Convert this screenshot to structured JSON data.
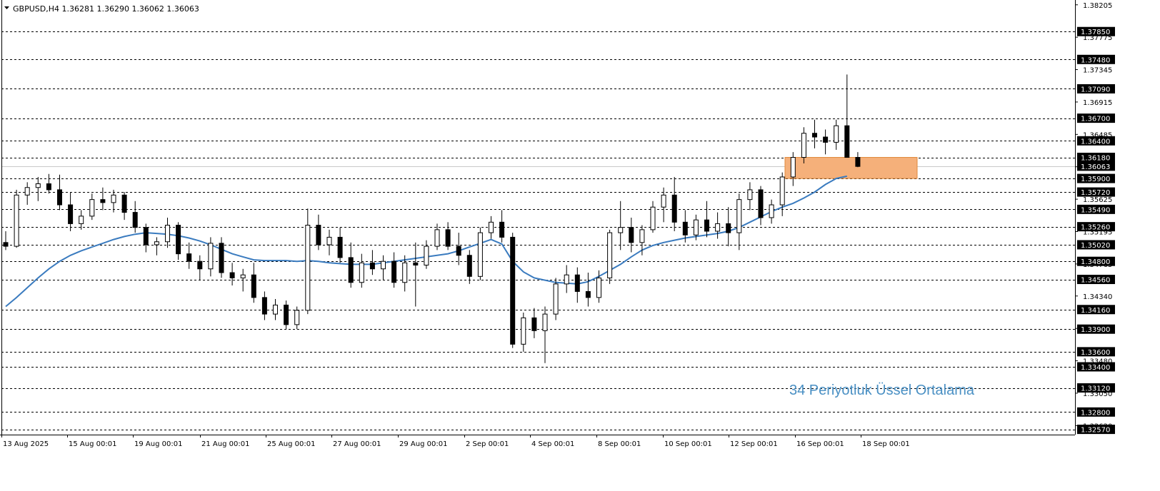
{
  "window": {
    "symbol_title": "GBPUSD,H4  1.36281 1.36290 1.36062 1.36063"
  },
  "annotation": "34 Periyotluk Üssel Ortalama",
  "colors": {
    "ema": "#3a7bbf",
    "zone_fill": "#f5b07a",
    "zone_border": "#e08a3c",
    "label_bg": "#000000",
    "label_text": "#ffffff",
    "grid": "#000000",
    "current_price_line": "#c8c8c8",
    "bear": "#000000",
    "bull": "#ffffff"
  },
  "chart_data": {
    "type": "candlestick",
    "symbol": "GBPUSD",
    "timeframe": "H4",
    "ohlc_header": {
      "open": 1.36281,
      "high": 1.3629,
      "low": 1.36062,
      "close": 1.36063
    },
    "ylim": [
      1.325,
      1.3825
    ],
    "y_tick_labels": [
      "1.38205",
      "1.37775",
      "1.37345",
      "1.36915",
      "1.36485",
      "1.36055",
      "1.35625",
      "1.35195",
      "1.34765",
      "1.34340",
      "1.33910",
      "1.33480",
      "1.33050",
      "1.32620"
    ],
    "horizontal_levels": [
      "1.37850",
      "1.37480",
      "1.37090",
      "1.36700",
      "1.36400",
      "1.36180",
      "1.35900",
      "1.35720",
      "1.35490",
      "1.35260",
      "1.35020",
      "1.34800",
      "1.34560",
      "1.34160",
      "1.33900",
      "1.33600",
      "1.33400",
      "1.33120",
      "1.32800",
      "1.32570"
    ],
    "current_price": "1.36063",
    "x_tick_labels": [
      "13 Aug 2025",
      "15 Aug 00:01",
      "19 Aug 00:01",
      "21 Aug 00:01",
      "25 Aug 00:01",
      "27 Aug 00:01",
      "29 Aug 00:01",
      "2 Sep 00:01",
      "4 Sep 00:01",
      "8 Sep 00:01",
      "10 Sep 00:01",
      "12 Sep 00:01",
      "16 Sep 00:01",
      "18 Sep 00:01"
    ],
    "zone": {
      "top": 1.3618,
      "bottom": 1.359
    },
    "ema_period": 34,
    "ema": [
      1.342,
      1.3432,
      1.3445,
      1.3458,
      1.347,
      1.348,
      1.3488,
      1.3494,
      1.3499,
      1.3504,
      1.3509,
      1.3513,
      1.3516,
      1.3518,
      1.3517,
      1.3516,
      1.3514,
      1.3511,
      1.3507,
      1.3502,
      1.3496,
      1.349,
      1.3486,
      1.3482,
      1.3481,
      1.3481,
      1.3481,
      1.348,
      1.3481,
      1.348,
      1.3478,
      1.3477,
      1.3476,
      1.3476,
      1.3476,
      1.3478,
      1.348,
      1.3482,
      1.3484,
      1.3486,
      1.3488,
      1.349,
      1.3494,
      1.3499,
      1.3504,
      1.3509,
      1.3503,
      1.348,
      1.3466,
      1.3458,
      1.3455,
      1.3452,
      1.3451,
      1.345,
      1.3453,
      1.346,
      1.3468,
      1.3476,
      1.3486,
      1.3495,
      1.3501,
      1.3505,
      1.3508,
      1.3511,
      1.3513,
      1.3515,
      1.3517,
      1.352,
      1.3525,
      1.3532,
      1.3539,
      1.3546,
      1.3552,
      1.3557,
      1.3564,
      1.3572,
      1.3582,
      1.359,
      1.3593
    ],
    "candles": [
      [
        1.3505,
        1.352,
        1.3495,
        1.35
      ],
      [
        1.35,
        1.3575,
        1.3498,
        1.3568
      ],
      [
        1.3568,
        1.3585,
        1.3555,
        1.3578
      ],
      [
        1.3578,
        1.3592,
        1.356,
        1.3583
      ],
      [
        1.3583,
        1.3596,
        1.357,
        1.3575
      ],
      [
        1.3575,
        1.3595,
        1.3548,
        1.3555
      ],
      [
        1.3555,
        1.3572,
        1.352,
        1.353
      ],
      [
        1.353,
        1.3548,
        1.3522,
        1.354
      ],
      [
        1.354,
        1.357,
        1.3535,
        1.3562
      ],
      [
        1.3562,
        1.3578,
        1.3548,
        1.3558
      ],
      [
        1.3558,
        1.3575,
        1.3545,
        1.3568
      ],
      [
        1.3568,
        1.3572,
        1.3535,
        1.3545
      ],
      [
        1.3545,
        1.356,
        1.3518,
        1.3525
      ],
      [
        1.3525,
        1.353,
        1.3492,
        1.3502
      ],
      [
        1.3502,
        1.3512,
        1.3488,
        1.3506
      ],
      [
        1.3506,
        1.3538,
        1.3498,
        1.3528
      ],
      [
        1.3528,
        1.3532,
        1.3482,
        1.349
      ],
      [
        1.349,
        1.3505,
        1.347,
        1.348
      ],
      [
        1.348,
        1.3488,
        1.3455,
        1.347
      ],
      [
        1.347,
        1.3512,
        1.346,
        1.3504
      ],
      [
        1.3504,
        1.3512,
        1.3458,
        1.3465
      ],
      [
        1.3465,
        1.3478,
        1.3448,
        1.3458
      ],
      [
        1.3458,
        1.347,
        1.344,
        1.3462
      ],
      [
        1.3462,
        1.3478,
        1.3425,
        1.3432
      ],
      [
        1.3432,
        1.344,
        1.3402,
        1.341
      ],
      [
        1.341,
        1.343,
        1.3402,
        1.3422
      ],
      [
        1.3422,
        1.3428,
        1.339,
        1.3396
      ],
      [
        1.3396,
        1.342,
        1.339,
        1.3415
      ],
      [
        1.3415,
        1.355,
        1.341,
        1.3528
      ],
      [
        1.3528,
        1.3542,
        1.3495,
        1.3502
      ],
      [
        1.3502,
        1.3522,
        1.3488,
        1.3512
      ],
      [
        1.3512,
        1.3525,
        1.3478,
        1.3485
      ],
      [
        1.3485,
        1.3505,
        1.3445,
        1.3452
      ],
      [
        1.3452,
        1.349,
        1.3445,
        1.3478
      ],
      [
        1.3478,
        1.3495,
        1.3462,
        1.347
      ],
      [
        1.347,
        1.3488,
        1.3455,
        1.348
      ],
      [
        1.348,
        1.3492,
        1.3445,
        1.3452
      ],
      [
        1.3452,
        1.3488,
        1.344,
        1.3478
      ],
      [
        1.3478,
        1.3505,
        1.342,
        1.3475
      ],
      [
        1.3475,
        1.3508,
        1.347,
        1.35
      ],
      [
        1.35,
        1.353,
        1.3495,
        1.3522
      ],
      [
        1.3522,
        1.3532,
        1.3495,
        1.35
      ],
      [
        1.35,
        1.3518,
        1.3475,
        1.3488
      ],
      [
        1.3488,
        1.3495,
        1.345,
        1.346
      ],
      [
        1.346,
        1.3525,
        1.3455,
        1.3518
      ],
      [
        1.3518,
        1.354,
        1.351,
        1.3532
      ],
      [
        1.3532,
        1.3548,
        1.3505,
        1.3512
      ],
      [
        1.3512,
        1.3518,
        1.3365,
        1.337
      ],
      [
        1.337,
        1.3412,
        1.336,
        1.3405
      ],
      [
        1.3405,
        1.3418,
        1.3378,
        1.3388
      ],
      [
        1.3388,
        1.342,
        1.3345,
        1.341
      ],
      [
        1.341,
        1.3458,
        1.3402,
        1.345
      ],
      [
        1.345,
        1.3475,
        1.3438,
        1.3462
      ],
      [
        1.3462,
        1.3472,
        1.3425,
        1.344
      ],
      [
        1.344,
        1.3465,
        1.342,
        1.3432
      ],
      [
        1.3432,
        1.3468,
        1.3425,
        1.3458
      ],
      [
        1.3458,
        1.3522,
        1.345,
        1.3518
      ],
      [
        1.3518,
        1.356,
        1.3495,
        1.3525
      ],
      [
        1.3525,
        1.3538,
        1.3492,
        1.3505
      ],
      [
        1.3505,
        1.3528,
        1.3488,
        1.3522
      ],
      [
        1.3522,
        1.356,
        1.3518,
        1.3552
      ],
      [
        1.3552,
        1.3578,
        1.3532,
        1.3568
      ],
      [
        1.3568,
        1.3592,
        1.352,
        1.3532
      ],
      [
        1.3532,
        1.3548,
        1.3505,
        1.3515
      ],
      [
        1.3515,
        1.3542,
        1.3508,
        1.3535
      ],
      [
        1.3535,
        1.356,
        1.3512,
        1.352
      ],
      [
        1.352,
        1.3545,
        1.351,
        1.353
      ],
      [
        1.353,
        1.3552,
        1.35,
        1.3518
      ],
      [
        1.3518,
        1.357,
        1.3495,
        1.3562
      ],
      [
        1.3562,
        1.3585,
        1.3548,
        1.3575
      ],
      [
        1.3575,
        1.358,
        1.3528,
        1.3538
      ],
      [
        1.3538,
        1.3562,
        1.353,
        1.3555
      ],
      [
        1.3555,
        1.3598,
        1.354,
        1.3592
      ],
      [
        1.3592,
        1.3625,
        1.358,
        1.3618
      ],
      [
        1.3618,
        1.3658,
        1.361,
        1.365
      ],
      [
        1.365,
        1.3668,
        1.363,
        1.3645
      ],
      [
        1.3645,
        1.3655,
        1.3622,
        1.3638
      ],
      [
        1.3638,
        1.3668,
        1.3628,
        1.366
      ],
      [
        1.366,
        1.3728,
        1.3618,
        1.3618
      ],
      [
        1.3618,
        1.3625,
        1.3605,
        1.3606
      ]
    ]
  }
}
